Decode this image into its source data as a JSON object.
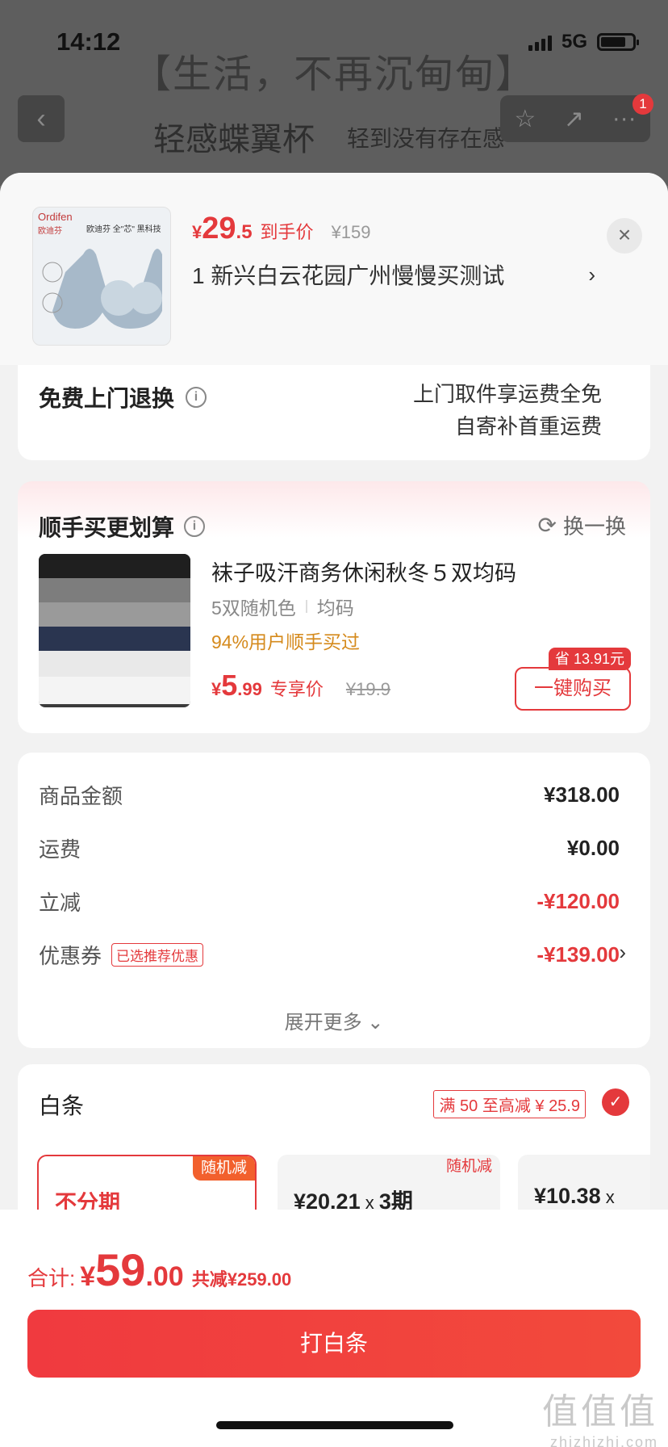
{
  "status_bar": {
    "time": "14:12",
    "network": "5G"
  },
  "background": {
    "banner_title": "【生活，不再沉甸甸】",
    "subtitle_main": "轻感蝶翼杯",
    "subtitle_side": "轻到没有存在感",
    "back_icon": "‹",
    "action_icons": [
      "☆",
      "↗",
      "···"
    ],
    "badge_count": "1"
  },
  "product": {
    "brand_en": "Ordifen",
    "brand_cn": "欧迪芬",
    "tagline": "欧迪芬 全\"芯\" 黑科技",
    "price_yen": "¥",
    "price_int": "29",
    "price_dec": ".5",
    "price_label": "到手价",
    "original_price": "¥159",
    "address": "1  新兴白云花园广州慢慢买测试",
    "address_arrow": "›",
    "close": "×"
  },
  "return_service": {
    "title": "免费上门退换",
    "info_icon": "i",
    "line1": "上门取件享运费全免",
    "line2": "自寄补首重运费"
  },
  "buy_more": {
    "title": "顺手买更划算",
    "info_icon": "i",
    "swap_label": "换一换",
    "swap_icon": "⟳",
    "item_name": "袜子吸汗商务休闲秋冬５双均码",
    "spec_color": "5双随机色",
    "spec_size": "均码",
    "buy_rate": "94%用户顺手买过",
    "price_yen": "¥",
    "price_int": "5",
    "price_dec": ".99",
    "price_label": "专享价",
    "original_price": "¥19.9",
    "save_badge": "省 13.91元",
    "button": "一键购买"
  },
  "amounts": {
    "rows": [
      {
        "label": "商品金额",
        "value": "¥318.00"
      },
      {
        "label": "运费",
        "value": "¥0.00"
      },
      {
        "label": "立减",
        "value": "-¥120.00"
      },
      {
        "label": "优惠券",
        "value": "-¥139.00",
        "tag": "已选推荐优惠",
        "arrow": "›"
      }
    ],
    "expand_more": "展开更多 ⌄"
  },
  "baitiao": {
    "title": "白条",
    "promo": "满 50 至高减 ¥ 25.9",
    "check_icon": "✓",
    "options": [
      {
        "label": "不分期",
        "tag": "随机减"
      },
      {
        "amount": "¥20.21",
        "x": " x ",
        "period": "3期",
        "tag": "随机减"
      },
      {
        "amount": "¥10.38",
        "x": " x",
        "period": ""
      }
    ]
  },
  "footer": {
    "total_label": "合计:",
    "total_yen": "¥",
    "total_int": "59",
    "total_dec": ".00",
    "total_saving": "共减¥259.00",
    "pay_button": "打白条",
    "watermark_big": "值值值",
    "watermark_small": "zhizhizhi.com"
  },
  "colors": {
    "accent": "#e4393c",
    "rate": "#d58a1c",
    "tag_orange": "#f2602d"
  }
}
